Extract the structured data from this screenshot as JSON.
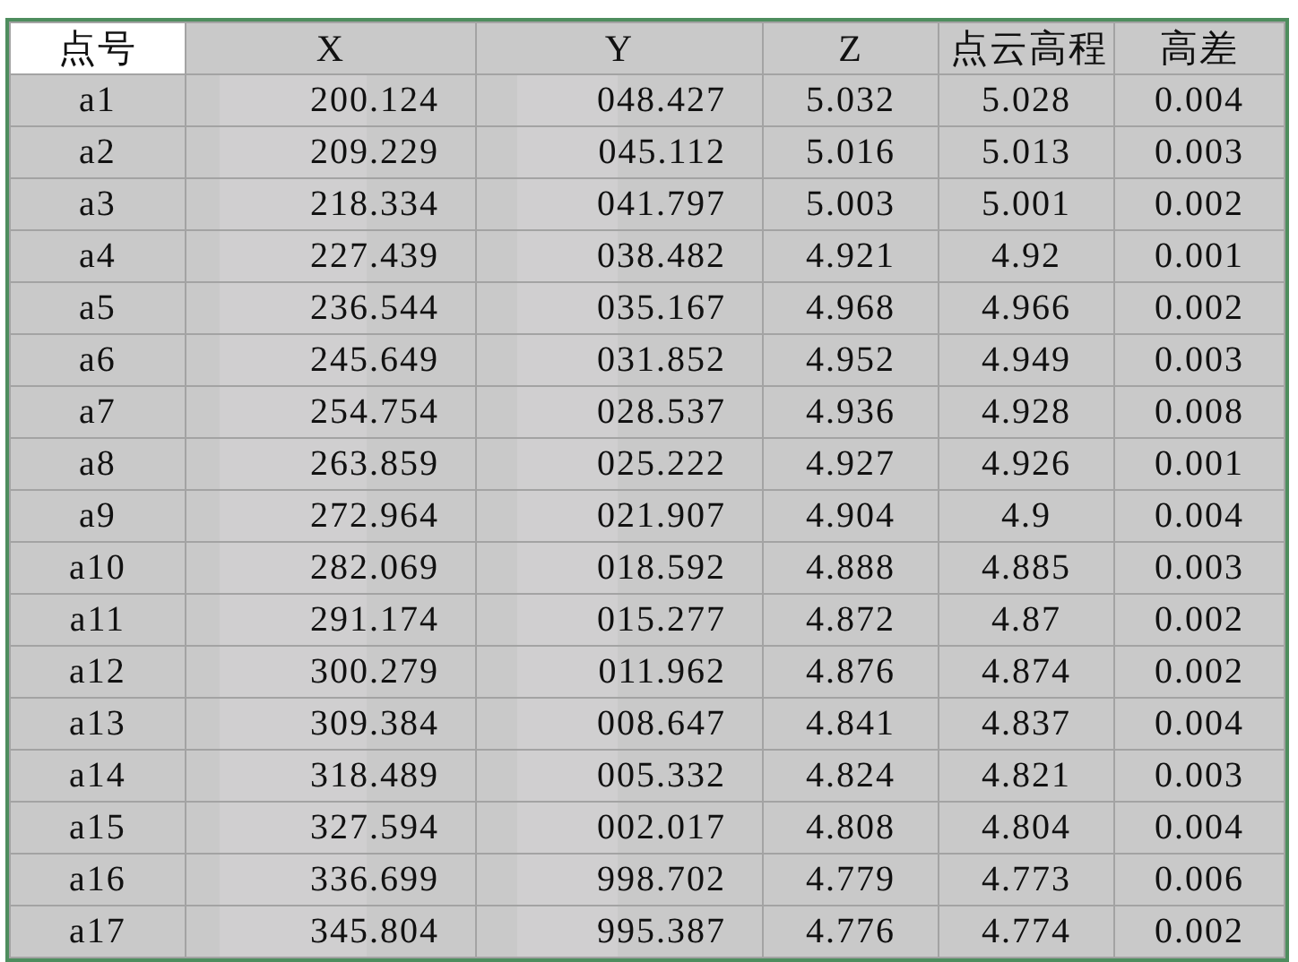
{
  "table": {
    "columns": [
      "点号",
      "X",
      "Y",
      "Z",
      "点云高程",
      "高差"
    ],
    "rows": [
      [
        "a1",
        "200.124",
        "048.427",
        "5.032",
        "5.028",
        "0.004"
      ],
      [
        "a2",
        "209.229",
        "045.112",
        "5.016",
        "5.013",
        "0.003"
      ],
      [
        "a3",
        "218.334",
        "041.797",
        "5.003",
        "5.001",
        "0.002"
      ],
      [
        "a4",
        "227.439",
        "038.482",
        "4.921",
        "4.92",
        "0.001"
      ],
      [
        "a5",
        "236.544",
        "035.167",
        "4.968",
        "4.966",
        "0.002"
      ],
      [
        "a6",
        "245.649",
        "031.852",
        "4.952",
        "4.949",
        "0.003"
      ],
      [
        "a7",
        "254.754",
        "028.537",
        "4.936",
        "4.928",
        "0.008"
      ],
      [
        "a8",
        "263.859",
        "025.222",
        "4.927",
        "4.926",
        "0.001"
      ],
      [
        "a9",
        "272.964",
        "021.907",
        "4.904",
        "4.9",
        "0.004"
      ],
      [
        "a10",
        "282.069",
        "018.592",
        "4.888",
        "4.885",
        "0.003"
      ],
      [
        "a11",
        "291.174",
        "015.277",
        "4.872",
        "4.87",
        "0.002"
      ],
      [
        "a12",
        "300.279",
        "011.962",
        "4.876",
        "4.874",
        "0.002"
      ],
      [
        "a13",
        "309.384",
        "008.647",
        "4.841",
        "4.837",
        "0.004"
      ],
      [
        "a14",
        "318.489",
        "005.332",
        "4.824",
        "4.821",
        "0.003"
      ],
      [
        "a15",
        "327.594",
        "002.017",
        "4.808",
        "4.804",
        "0.004"
      ],
      [
        "a16",
        "336.699",
        "998.702",
        "4.779",
        "4.773",
        "0.006"
      ],
      [
        "a17",
        "345.804",
        "995.387",
        "4.776",
        "4.774",
        "0.002"
      ]
    ]
  }
}
